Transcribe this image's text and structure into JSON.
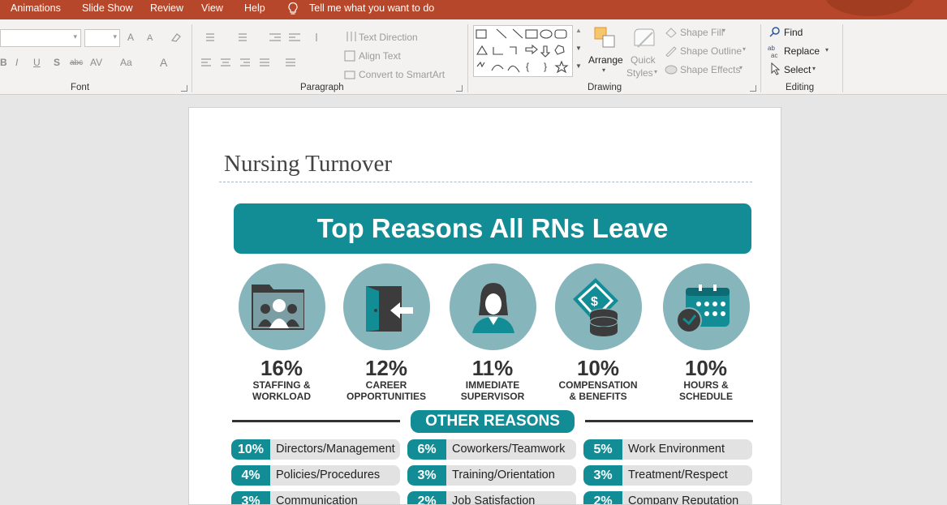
{
  "menu": {
    "tabs": [
      "Animations",
      "Slide Show",
      "Review",
      "View",
      "Help"
    ],
    "tell_me": "Tell me what you want to do"
  },
  "ribbon": {
    "font": {
      "label": "Font",
      "grow": "A",
      "shrink": "A",
      "bold": "B",
      "italic": "I",
      "underline": "U",
      "shadow": "S",
      "strike": "abc",
      "spacing": "AV",
      "change_case": "Aa",
      "color": "A"
    },
    "paragraph": {
      "label": "Paragraph",
      "text_direction": "Text Direction",
      "align_text": "Align Text",
      "smartart": "Convert to SmartArt"
    },
    "drawing": {
      "label": "Drawing",
      "arrange": "Arrange",
      "quick": "Quick",
      "styles": "Styles",
      "shape_fill": "Shape Fill",
      "shape_outline": "Shape Outline",
      "shape_effects": "Shape Effects"
    },
    "editing": {
      "label": "Editing",
      "find": "Find",
      "replace": "Replace",
      "select": "Select"
    }
  },
  "slide": {
    "title": "Nursing Turnover",
    "banner": "Top Reasons All RNs Leave",
    "top_reasons": [
      {
        "pct": "16%",
        "line1": "STAFFING &",
        "line2": "WORKLOAD",
        "icon": "staff-folder-icon"
      },
      {
        "pct": "12%",
        "line1": "CAREER",
        "line2": "OPPORTUNITIES",
        "icon": "exit-door-icon"
      },
      {
        "pct": "11%",
        "line1": "IMMEDIATE",
        "line2": "SUPERVISOR",
        "icon": "supervisor-icon"
      },
      {
        "pct": "10%",
        "line1": "COMPENSATION",
        "line2": "& BENEFITS",
        "icon": "money-coins-icon"
      },
      {
        "pct": "10%",
        "line1": "HOURS &",
        "line2": "SCHEDULE",
        "icon": "calendar-clock-icon"
      }
    ],
    "other_heading": "OTHER REASONS",
    "other_reasons": [
      {
        "pct": "10%",
        "label": "Directors/Management"
      },
      {
        "pct": "6%",
        "label": "Coworkers/Teamwork"
      },
      {
        "pct": "5%",
        "label": "Work Environment"
      },
      {
        "pct": "4%",
        "label": "Policies/Procedures"
      },
      {
        "pct": "3%",
        "label": "Training/Orientation"
      },
      {
        "pct": "3%",
        "label": "Treatment/Respect"
      },
      {
        "pct": "3%",
        "label": "Communication"
      },
      {
        "pct": "2%",
        "label": "Job Satisfaction"
      },
      {
        "pct": "2%",
        "label": "Company Reputation"
      }
    ]
  },
  "colors": {
    "menu_bar": "#b7472a",
    "teal": "#128d96",
    "circle": "#86b5bb"
  }
}
